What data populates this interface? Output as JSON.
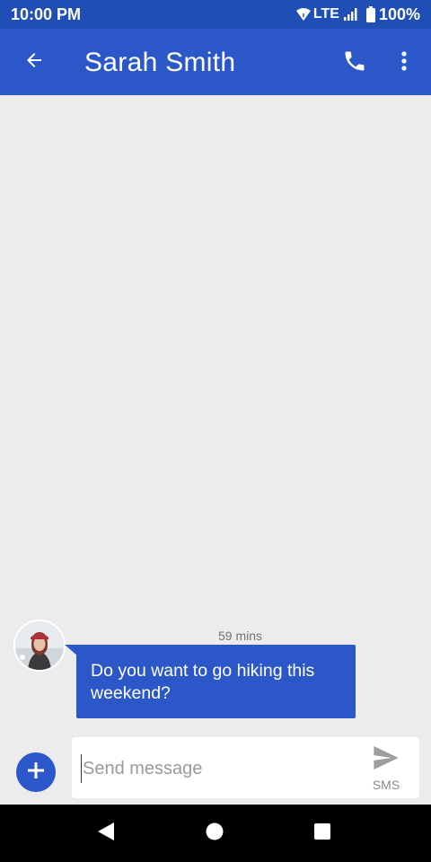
{
  "status_bar": {
    "time": "10:00 PM",
    "network": "LTE",
    "battery": "100%",
    "icons": [
      "wifi-icon",
      "signal-icon",
      "battery-icon"
    ]
  },
  "app_bar": {
    "title": "Sarah Smith",
    "back_icon": "arrow-back-icon",
    "call_icon": "phone-icon",
    "more_icon": "more-vert-icon"
  },
  "conversation": {
    "messages": [
      {
        "direction": "incoming",
        "timestamp": "59 mins",
        "text": "Do you want to go hiking this weekend?",
        "avatar": "contact-avatar"
      }
    ]
  },
  "composer": {
    "add_icon": "plus-icon",
    "input_value": "",
    "placeholder": "Send message",
    "send_icon": "send-icon",
    "send_label": "SMS"
  },
  "nav_bar": {
    "buttons": [
      "back-triangle-icon",
      "home-circle-icon",
      "recents-square-icon"
    ]
  },
  "colors": {
    "primary": "#2b57c9",
    "status_bar": "#1f4fb4",
    "background": "#ececec"
  }
}
